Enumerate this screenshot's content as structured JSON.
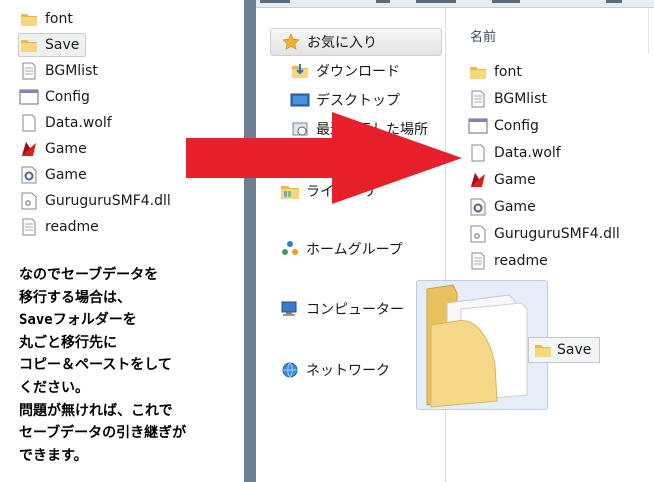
{
  "left_files": [
    {
      "name": "font",
      "icon": "folder-icon"
    },
    {
      "name": "Save",
      "icon": "folder-icon",
      "selected": true
    },
    {
      "name": "BGMlist",
      "icon": "text-file-icon"
    },
    {
      "name": "Config",
      "icon": "window-icon"
    },
    {
      "name": "Data.wolf",
      "icon": "blank-file-icon"
    },
    {
      "name": "Game",
      "icon": "game-red-icon"
    },
    {
      "name": "Game",
      "icon": "gear-config-icon"
    },
    {
      "name": "GuruguruSMF4.dll",
      "icon": "dll-gear-icon"
    },
    {
      "name": "readme",
      "icon": "text-file-icon"
    }
  ],
  "instruction_lines": [
    "なのでセーブデータを",
    "移行する場合は、",
    "Saveフォルダーを",
    "丸ごと移行先に",
    "コピー＆ペーストをして",
    "ください。",
    "問題が無ければ、これで",
    "セーブデータの引き継ぎが",
    "できます。"
  ],
  "nav": {
    "favorites": "お気に入り",
    "downloads": "ダウンロード",
    "desktop": "デスクトップ",
    "recent": "最近表示した場所",
    "libraries": "ライブラリ",
    "homegroup": "ホームグループ",
    "computer": "コンピューター",
    "network": "ネットワーク"
  },
  "content": {
    "column_header": "名前",
    "files": [
      {
        "name": "font",
        "icon": "folder-icon"
      },
      {
        "name": "BGMlist",
        "icon": "text-file-icon"
      },
      {
        "name": "Config",
        "icon": "window-icon"
      },
      {
        "name": "Data.wolf",
        "icon": "blank-file-icon"
      },
      {
        "name": "Game",
        "icon": "game-red-icon"
      },
      {
        "name": "Game",
        "icon": "gear-config-icon"
      },
      {
        "name": "GuruguruSMF4.dll",
        "icon": "dll-gear-icon"
      },
      {
        "name": "readme",
        "icon": "text-file-icon"
      }
    ]
  },
  "drag": {
    "label": "Save"
  },
  "colors": {
    "arrow": "#e8202a",
    "folder": "#f2cf6b",
    "selection": "#eef0f2",
    "window_frame": "#6e7f93"
  }
}
